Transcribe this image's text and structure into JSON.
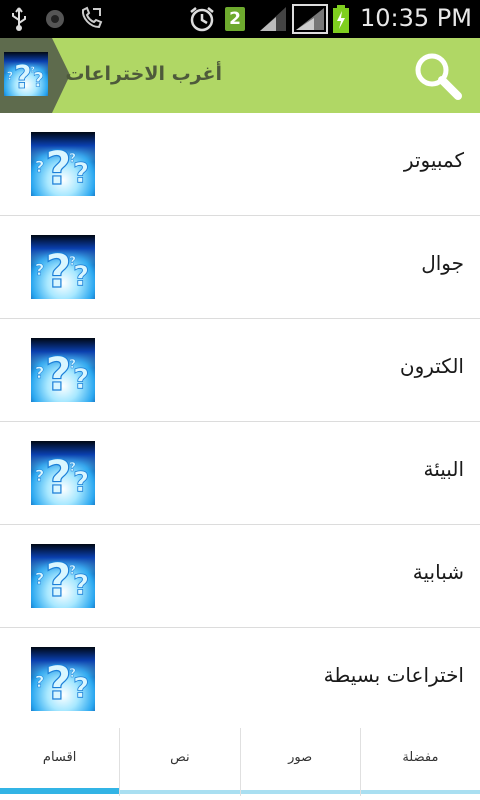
{
  "status_bar": {
    "time": "10:35 PM",
    "notification_badge": "2",
    "icons": [
      "usb-icon",
      "voicemail-icon",
      "call-forward-icon",
      "alarm-icon",
      "signal-icon",
      "battery-charging-icon"
    ]
  },
  "header": {
    "title": "أغرب الاختراعات",
    "background": "#b0d765"
  },
  "list": {
    "items": [
      {
        "label": "كمبيوتر"
      },
      {
        "label": "جوال"
      },
      {
        "label": "الكترون"
      },
      {
        "label": "البيئة"
      },
      {
        "label": "شبابية"
      },
      {
        "label": "اختراعات بسيطة"
      }
    ]
  },
  "tabs": {
    "items": [
      {
        "label": "اقسام",
        "active": true
      },
      {
        "label": "نص",
        "active": false
      },
      {
        "label": "صور",
        "active": false
      },
      {
        "label": "مفضلة",
        "active": false
      }
    ],
    "accent": "#32b4e5"
  }
}
